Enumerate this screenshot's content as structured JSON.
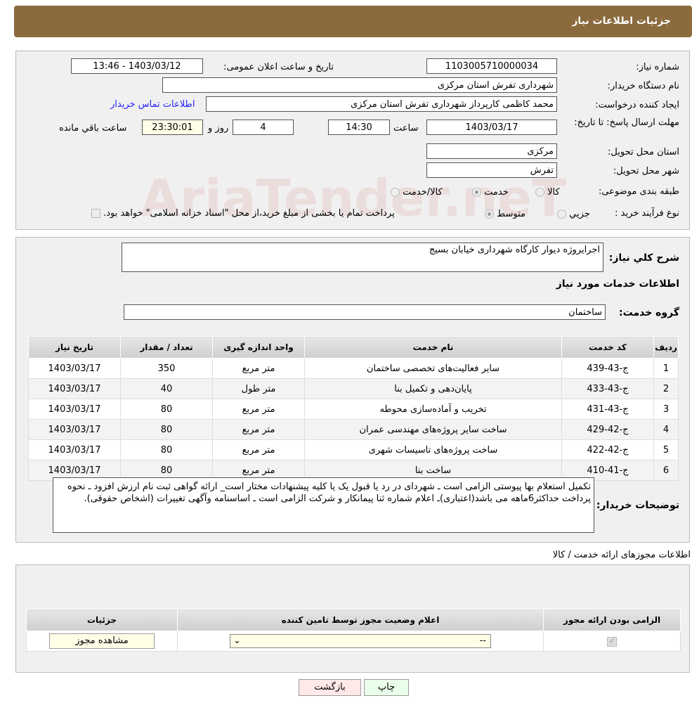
{
  "header": {
    "title": "جزئیات اطلاعات نیاز"
  },
  "info": {
    "need_number_label": "شماره نیاز:",
    "need_number": "1103005710000034",
    "announce_label": "تاریخ و ساعت اعلان عمومی:",
    "announce_value": "1403/03/12 - 13:46",
    "buyer_label": "نام دستگاه خریدار:",
    "buyer": "شهرداری تفرش استان مرکزی",
    "creator_label": "ایجاد کننده درخواست:",
    "creator": "محمد کاظمی کارپرداز شهرداری تفرش استان مرکزی",
    "contact_link": "اطلاعات تماس خریدار",
    "deadline_label": "مهلت ارسال پاسخ: تا تاریخ:",
    "deadline_date": "1403/03/17",
    "time_label": "ساعت",
    "deadline_time": "14:30",
    "days": "4",
    "days_label": "روز و",
    "remaining": "23:30:01",
    "remaining_label": "ساعت باقي مانده",
    "province_label": "استان محل تحویل:",
    "province": "مرکزی",
    "city_label": "شهر محل تحویل:",
    "city": "تفرش",
    "category_label": "طبقه بندی موضوعی:",
    "category_options": [
      "کالا",
      "خدمت",
      "کالا/خدمت"
    ],
    "category_selected": "خدمت",
    "process_label": "نوع فرآیند خرید :",
    "process_options": [
      "جزیي",
      "متوسط"
    ],
    "process_selected": "متوسط",
    "payment_note": "پرداخت تمام یا بخشی از مبلغ خرید،از محل \"اسناد خزانه اسلامی\" خواهد بود."
  },
  "watermark": "AriaTender.neT",
  "details": {
    "desc_label": "شرح کلي نياز:",
    "desc": "اجرایروژه دیوار کارگاه شهرداری خیابان بسیج",
    "services_title": "اطلاعات خدمات مورد نیاز",
    "group_label": "گروه خدمت:",
    "group": "ساختمان",
    "table": {
      "headers": [
        "ردیف",
        "کد خدمت",
        "نام خدمت",
        "واحد اندازه گیری",
        "تعداد / مقدار",
        "تاریخ نیاز"
      ],
      "rows": [
        [
          "1",
          "ج-43-439",
          "سایر فعالیت‌های تخصصی ساختمان",
          "متر مربع",
          "350",
          "1403/03/17"
        ],
        [
          "2",
          "ج-43-433",
          "پایان‌دهی و تکمیل بنا",
          "متر طول",
          "40",
          "1403/03/17"
        ],
        [
          "3",
          "ج-43-431",
          "تخریب و آماده‌سازی محوطه",
          "متر مربع",
          "80",
          "1403/03/17"
        ],
        [
          "4",
          "ج-42-429",
          "ساخت سایر پروژه‌های مهندسی عمران",
          "متر مربع",
          "80",
          "1403/03/17"
        ],
        [
          "5",
          "ج-42-422",
          "ساخت پروژه‌های تاسیسات شهری",
          "متر مربع",
          "80",
          "1403/03/17"
        ],
        [
          "6",
          "ج-41-410",
          "ساخت بنا",
          "متر مربع",
          "80",
          "1403/03/17"
        ]
      ]
    },
    "buyer_notes_label": "توضیحات خریدار:",
    "buyer_notes": "تکمیل استعلام بها پیوستی الزامی است ـ شهردای در رد یا قبول یک یا کلیه پیشنهادات مختار است_ ارائه گواهی ثبت نام ارزش افزود ـ نحوه پرداخت حداکثر6ماهه می باشد(اعتباری)ـ اعلام شماره ثنا پیمانکار و شرکت الزامی است ـ اساسنامه وآگهی تغییرات (اشخاص حقوقی)."
  },
  "permits": {
    "title": "اطلاعات مجوزهای ارائه خدمت / کالا",
    "headers": [
      "الزامی بودن ارائه مجوز",
      "اعلام وضعیت مجوز توسط تامین کننده",
      "جزئیات"
    ],
    "select_value": "--",
    "view_button": "مشاهده مجوز"
  },
  "buttons": {
    "print": "چاپ",
    "back": "بازگشت"
  }
}
